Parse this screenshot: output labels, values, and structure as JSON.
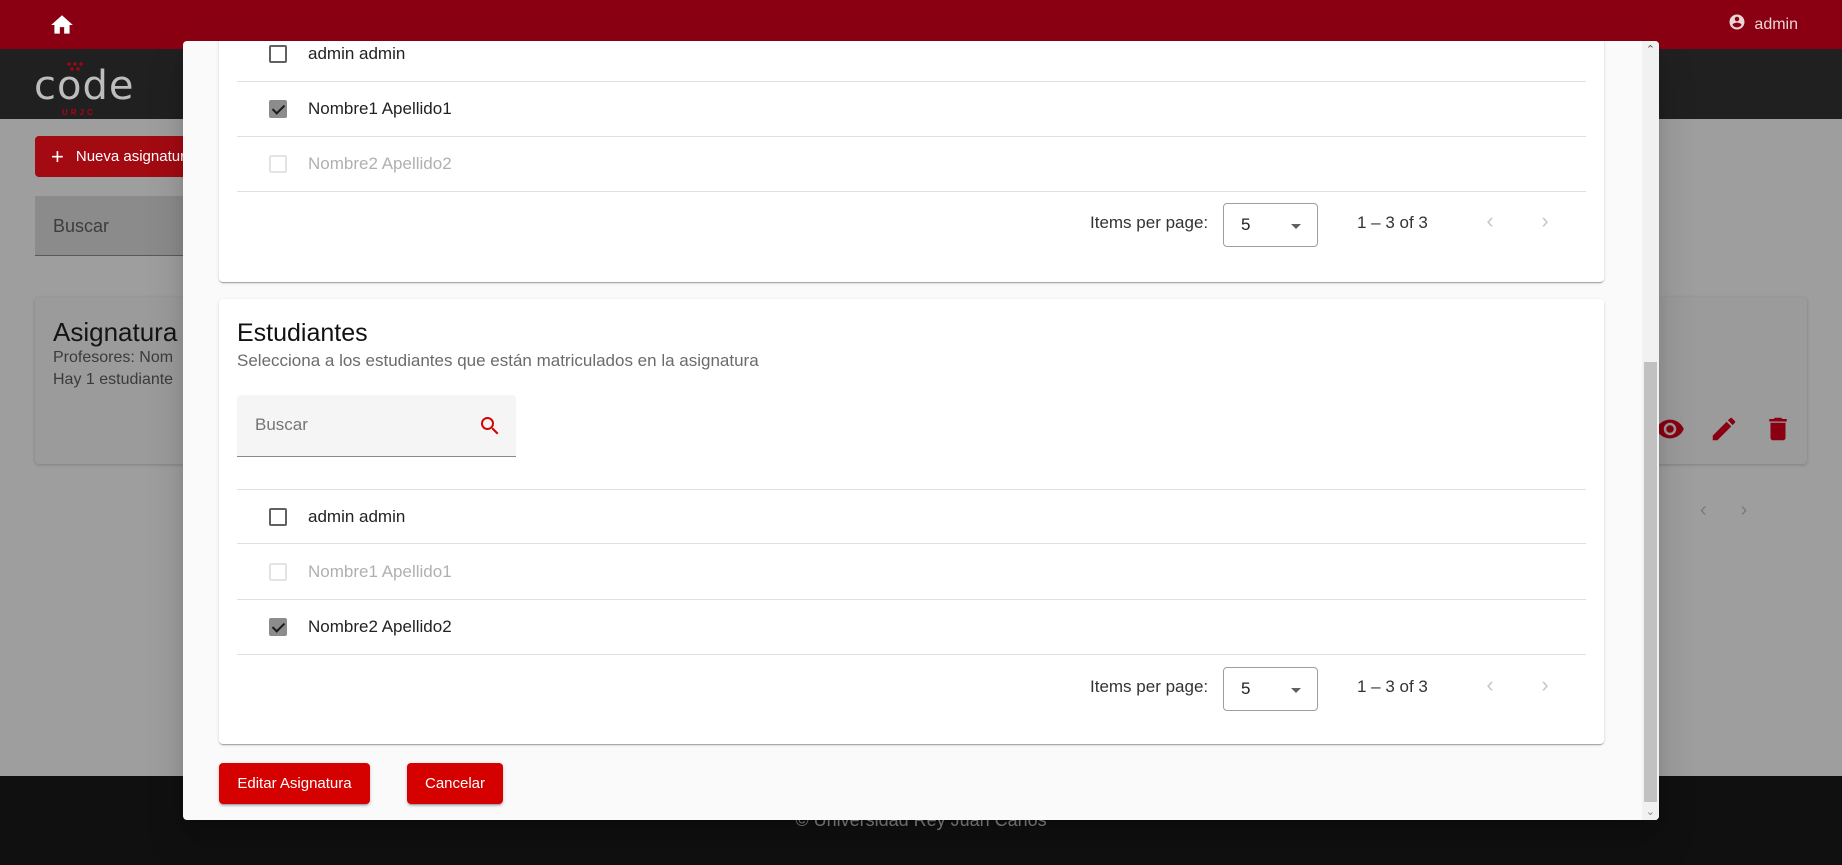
{
  "topbar": {
    "user_name": "admin",
    "accent": "#8a0012"
  },
  "logo": {
    "word": "code",
    "sub": "URJC"
  },
  "page": {
    "new_button_label": "Nueva asignatura",
    "search_placeholder": "Buscar",
    "card": {
      "title": "Asignatura",
      "teachers": "Profesores: Nom",
      "students": "Hay 1 estudiante"
    }
  },
  "footer": {
    "text": "© Universidad Rey Juan Carlos"
  },
  "modal": {
    "teachers_list": {
      "rows": [
        {
          "label": "admin admin",
          "checked": false,
          "disabled": false
        },
        {
          "label": "Nombre1 Apellido1",
          "checked": true,
          "disabled": false
        },
        {
          "label": "Nombre2 Apellido2",
          "checked": false,
          "disabled": true
        }
      ],
      "paginator": {
        "items_label": "Items per page:",
        "page_size": "5",
        "range": "1 – 3 of 3"
      }
    },
    "students": {
      "title": "Estudiantes",
      "subtitle": "Selecciona a los estudiantes que están matriculados en la asignatura",
      "search_placeholder": "Buscar",
      "rows": [
        {
          "label": "admin admin",
          "checked": false,
          "disabled": false
        },
        {
          "label": "Nombre1 Apellido1",
          "checked": false,
          "disabled": true
        },
        {
          "label": "Nombre2 Apellido2",
          "checked": true,
          "disabled": false
        }
      ],
      "paginator": {
        "items_label": "Items per page:",
        "page_size": "5",
        "range": "1 – 3 of 3"
      }
    },
    "buttons": {
      "edit": "Editar Asignatura",
      "cancel": "Cancelar"
    },
    "primary_color": "#d50000"
  }
}
